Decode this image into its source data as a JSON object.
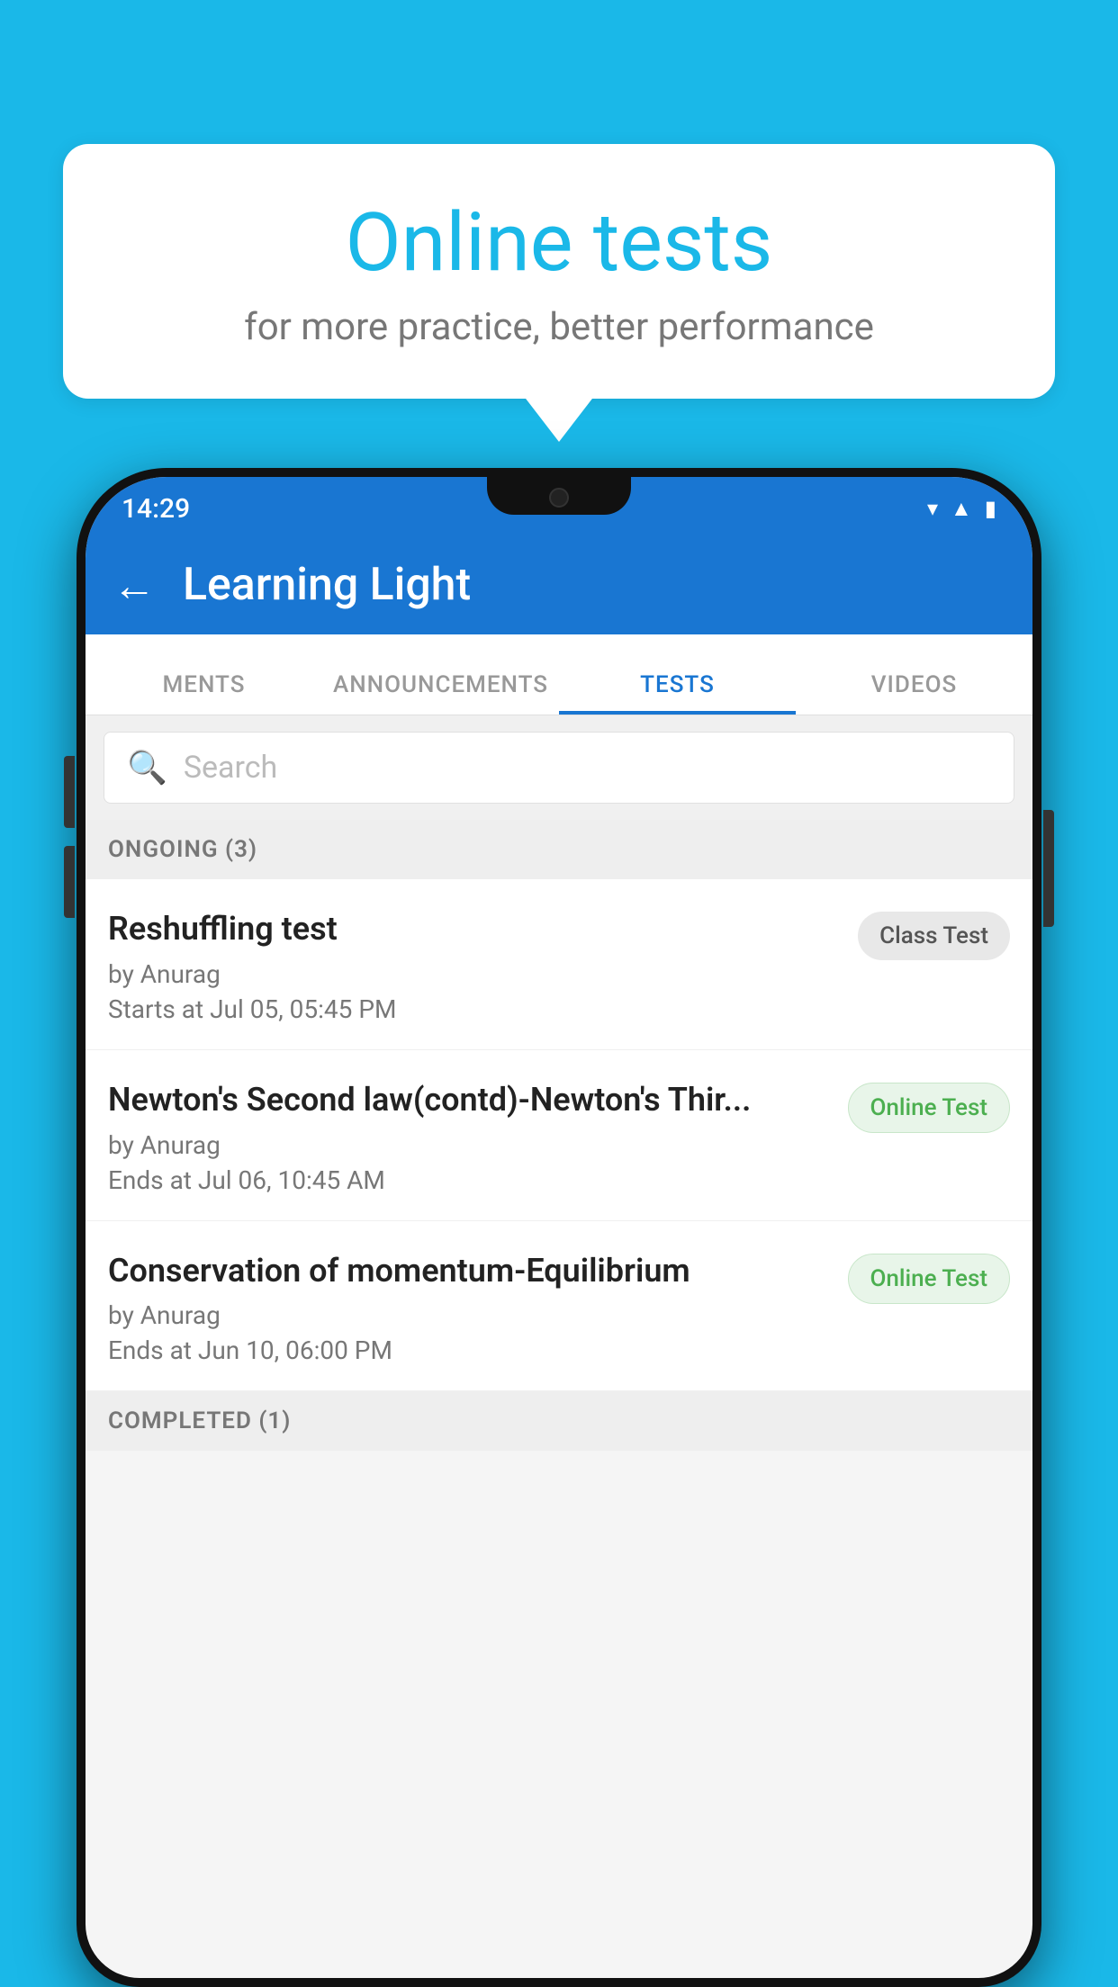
{
  "background": {
    "color": "#1ab8e8"
  },
  "bubble": {
    "title": "Online tests",
    "subtitle": "for more practice, better performance"
  },
  "phone": {
    "statusBar": {
      "time": "14:29",
      "icons": [
        "wifi",
        "signal",
        "battery"
      ]
    },
    "appBar": {
      "title": "Learning Light",
      "backLabel": "←"
    },
    "tabs": [
      {
        "label": "MENTS",
        "active": false
      },
      {
        "label": "ANNOUNCEMENTS",
        "active": false
      },
      {
        "label": "TESTS",
        "active": true
      },
      {
        "label": "VIDEOS",
        "active": false
      }
    ],
    "search": {
      "placeholder": "Search"
    },
    "ongoing": {
      "sectionLabel": "ONGOING (3)",
      "tests": [
        {
          "name": "Reshuffling test",
          "by": "by Anurag",
          "date": "Starts at  Jul 05, 05:45 PM",
          "badge": "Class Test",
          "badgeType": "class"
        },
        {
          "name": "Newton's Second law(contd)-Newton's Thir...",
          "by": "by Anurag",
          "date": "Ends at  Jul 06, 10:45 AM",
          "badge": "Online Test",
          "badgeType": "online"
        },
        {
          "name": "Conservation of momentum-Equilibrium",
          "by": "by Anurag",
          "date": "Ends at  Jun 10, 06:00 PM",
          "badge": "Online Test",
          "badgeType": "online"
        }
      ]
    },
    "completed": {
      "sectionLabel": "COMPLETED (1)"
    }
  }
}
